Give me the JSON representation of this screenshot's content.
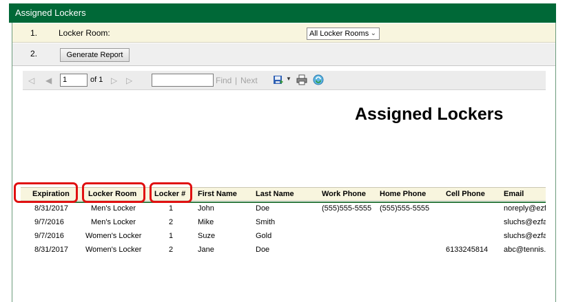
{
  "header": {
    "title": "Assigned Lockers"
  },
  "steps": [
    {
      "number": "1.",
      "label": "Locker Room:"
    },
    {
      "number": "2."
    }
  ],
  "locker_room_select": {
    "value": "All Locker Rooms"
  },
  "generate_button": {
    "label": "Generate Report"
  },
  "toolbar": {
    "page_value": "1",
    "of_text": "of 1",
    "find_value": "",
    "find_label": "Find",
    "separator": "|",
    "next_label": "Next"
  },
  "report": {
    "title": "Assigned Lockers",
    "columns": [
      "Expiration",
      "Locker Room",
      "Locker #",
      "First Name",
      "Last Name",
      "Work Phone",
      "Home Phone",
      "Cell Phone",
      "Email"
    ],
    "rows": [
      [
        "8/31/2017",
        "Men's Locker",
        "1",
        "John",
        "Doe",
        "(555)555-5555",
        "(555)555-5555",
        "",
        "noreply@ezf"
      ],
      [
        "9/7/2016",
        "Men's Locker",
        "2",
        "Mike",
        "Smith",
        "",
        "",
        "",
        "sluchs@ezfa"
      ],
      [
        "9/7/2016",
        "Women's Locker",
        "1",
        "Suze",
        "Gold",
        "",
        "",
        "",
        "sluchs@ezfa"
      ],
      [
        "8/31/2017",
        "Women's Locker",
        "2",
        "Jane",
        "Doe",
        "",
        "",
        "6133245814",
        "abc@tennis."
      ]
    ]
  },
  "colors": {
    "header_green": "#006837",
    "highlight_red": "#e01010",
    "step_bg": "#f8f5de"
  }
}
